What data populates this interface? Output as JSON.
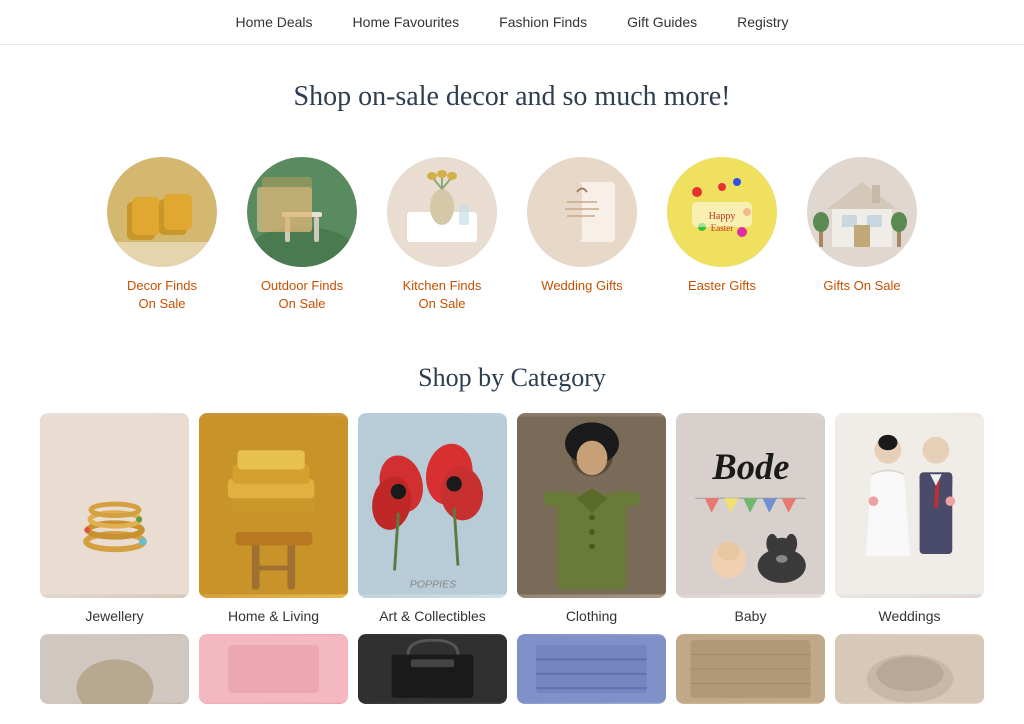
{
  "nav": {
    "items": [
      {
        "label": "Home Deals",
        "id": "home-deals"
      },
      {
        "label": "Home Favourites",
        "id": "home-favourites"
      },
      {
        "label": "Fashion Finds",
        "id": "fashion-finds"
      },
      {
        "label": "Gift Guides",
        "id": "gift-guides"
      },
      {
        "label": "Registry",
        "id": "registry"
      }
    ]
  },
  "hero": {
    "heading": "Shop on-sale decor and so much more!"
  },
  "circles": {
    "items": [
      {
        "id": "decor-finds",
        "label": "Decor Finds\nOn Sale",
        "colorClass": "circle-decor"
      },
      {
        "id": "outdoor-finds",
        "label": "Outdoor Finds\nOn Sale",
        "colorClass": "circle-outdoor"
      },
      {
        "id": "kitchen-finds",
        "label": "Kitchen Finds\nOn Sale",
        "colorClass": "circle-kitchen"
      },
      {
        "id": "wedding-gifts",
        "label": "Wedding Gifts",
        "colorClass": "circle-wedding"
      },
      {
        "id": "easter-gifts",
        "label": "Easter Gifts",
        "colorClass": "circle-easter"
      },
      {
        "id": "gifts-on-sale",
        "label": "Gifts On Sale",
        "colorClass": "circle-gifts"
      }
    ]
  },
  "shopByCategory": {
    "heading": "Shop by Category",
    "items": [
      {
        "id": "jewellery",
        "label": "Jewellery",
        "colorClass": "card-jewellery"
      },
      {
        "id": "home-living",
        "label": "Home & Living",
        "colorClass": "card-homeliving"
      },
      {
        "id": "art-collectibles",
        "label": "Art & Collectibles",
        "colorClass": "card-art",
        "sublabel": "POPPIES"
      },
      {
        "id": "clothing",
        "label": "Clothing",
        "colorClass": "card-clothing"
      },
      {
        "id": "baby",
        "label": "Baby",
        "colorClass": "card-baby"
      },
      {
        "id": "weddings",
        "label": "Weddings",
        "colorClass": "card-weddings"
      }
    ],
    "row2": [
      {
        "id": "row2-1",
        "colorClass": "card2-1"
      },
      {
        "id": "row2-2",
        "colorClass": "card2-2"
      },
      {
        "id": "row2-3",
        "colorClass": "card2-3"
      },
      {
        "id": "row2-4",
        "colorClass": "card2-4"
      },
      {
        "id": "row2-5",
        "colorClass": "card2-5"
      },
      {
        "id": "row2-6",
        "colorClass": "card2-6"
      }
    ]
  }
}
